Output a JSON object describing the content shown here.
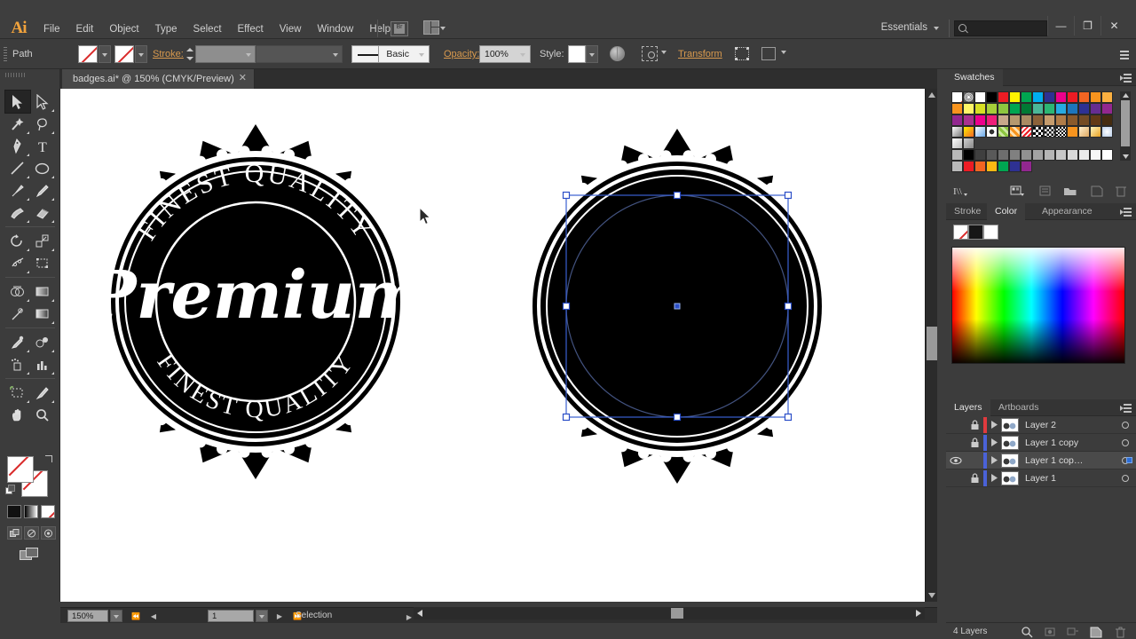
{
  "app": {
    "name": "Adobe Illustrator",
    "logo_text": "Ai"
  },
  "menubar": {
    "items": [
      "File",
      "Edit",
      "Object",
      "Type",
      "Select",
      "Effect",
      "View",
      "Window",
      "Help"
    ],
    "workspace": "Essentials",
    "search_placeholder": "",
    "bridge_icon": "bridge-icon",
    "arrange_icon": "arrange-documents-icon",
    "window_buttons": {
      "minimize": "—",
      "restore": "❐",
      "close": "✕"
    }
  },
  "controlbar": {
    "selection_type": "Path",
    "fill_label": "fill-none",
    "stroke_label": "Stroke:",
    "stroke_weight": "",
    "stroke_profile": "",
    "brush_definition": "Basic",
    "opacity_label": "Opacity:",
    "opacity_value": "100%",
    "style_label": "Style:",
    "transform_label": "Transform",
    "isolate_icon": "isolate-group-icon",
    "align_icon": "align-icon",
    "recolor_icon": "recolor-artwork-icon",
    "flyout_icon": "panel-menu-icon"
  },
  "document_tab": {
    "title": "badges.ai* @ 150% (CMYK/Preview)",
    "close": "✕"
  },
  "toolbar": {
    "tools": [
      "selection-tool",
      "direct-selection-tool",
      "magic-wand-tool",
      "lasso-tool",
      "pen-tool",
      "type-tool",
      "line-segment-tool",
      "ellipse-tool",
      "paintbrush-tool",
      "pencil-tool",
      "blob-brush-tool",
      "eraser-tool",
      "rotate-tool",
      "scale-tool",
      "width-tool",
      "free-transform-tool",
      "shape-builder-tool",
      "perspective-grid-tool",
      "mesh-tool",
      "gradient-tool",
      "eyedropper-tool",
      "blend-tool",
      "symbol-sprayer-tool",
      "column-graph-tool",
      "artboard-tool",
      "slice-tool",
      "hand-tool",
      "zoom-tool"
    ],
    "selected_tool": "selection-tool",
    "fill_color": "none",
    "stroke_color": "none",
    "color_modes": [
      "color-mode",
      "gradient-mode",
      "none-mode"
    ],
    "draw_modes": [
      "draw-normal",
      "draw-behind",
      "draw-inside"
    ],
    "screen_mode": "change-screen-mode"
  },
  "canvas": {
    "badge_left": {
      "top_arc_text": "FINEST QUALITY",
      "center_text": "Premium",
      "bottom_arc_text": "FINEST QUALITY",
      "fill": "#000000"
    },
    "badge_right": {
      "selection": "circle-path-selected",
      "selection_color": "#2b4ec7",
      "fill": "#000000"
    },
    "cursor": "arrow-cursor"
  },
  "statusbar": {
    "zoom_level": "150%",
    "page_number": "1",
    "status_text": "Selection"
  },
  "panels": {
    "swatches": {
      "tab": "Swatches",
      "rows": [
        [
          "none",
          "registration",
          "#ffffff",
          "#000000",
          "#ed1c24",
          "#fff200",
          "#00a651",
          "#00aeef",
          "#2e3192",
          "#ec008c",
          "#ed1c24",
          "#f26522",
          "#f7941e",
          "#fbb040"
        ],
        [
          "#f7941e",
          "#fff568",
          "#d7df23",
          "#a6ce39",
          "#8dc63f",
          "#00a651",
          "#007934",
          "#4bb798",
          "#2bb673",
          "#27aae1",
          "#1c75bc",
          "#2e3192",
          "#662d91",
          "#92278f"
        ],
        [
          "#92278f",
          "#a9318f",
          "#ec008c",
          "#ed1e79",
          "#c8a88b",
          "#b5996f",
          "#a98b63",
          "#8c6239",
          "#c69c6d",
          "#b07c48",
          "#8a5a2b",
          "#754c24",
          "#633a16",
          "#452c10"
        ],
        [
          "gradient-white-black",
          "gradient-orange",
          "gradient-blue",
          "pattern-dot",
          "pattern-leaf",
          "pattern-floral",
          "pattern-red",
          "pattern-poly1",
          "pattern-poly2",
          "pattern-poly3",
          "#f7941e",
          "gradient-tan",
          "gradient-gold",
          "gradient-radial"
        ],
        [
          "gradient-silver",
          "gradient-grey"
        ],
        [
          "folder",
          "#000000",
          "#3f3f3f",
          "#595959",
          "#6e6e6e",
          "#808080",
          "#919191",
          "#a3a3a3",
          "#b5b5b5",
          "#c7c7c7",
          "#d9d9d9",
          "#ebebeb",
          "#f7f7f7",
          "#ffffff"
        ],
        [
          "folder",
          "#ed1c24",
          "#f26522",
          "#fdb913",
          "#00a651",
          "#2e3192",
          "#92278f"
        ]
      ],
      "footer_icons": [
        "swatch-libraries-icon",
        "show-swatch-kinds-icon",
        "swatch-options-icon",
        "new-color-group-icon",
        "new-swatch-icon",
        "delete-swatch-icon"
      ]
    },
    "color": {
      "tabs": [
        "Stroke",
        "Color",
        "Appearance"
      ],
      "active_tab": "Color",
      "chips": [
        "none",
        "#161616",
        "#ffffff"
      ],
      "spectrum": "cmyk-spectrum"
    },
    "layers": {
      "tabs": [
        "Layers",
        "Artboards"
      ],
      "active_tab": "Layers",
      "rows": [
        {
          "name": "Layer 2",
          "visible": false,
          "locked": true,
          "color": "#e03a3e",
          "selected": false
        },
        {
          "name": "Layer 1 copy",
          "visible": false,
          "locked": true,
          "color": "#4a62d8",
          "selected": false
        },
        {
          "name": "Layer 1 cop…",
          "visible": true,
          "locked": false,
          "color": "#4a62d8",
          "selected": true
        },
        {
          "name": "Layer 1",
          "visible": false,
          "locked": true,
          "color": "#4a62d8",
          "selected": false
        }
      ],
      "footer_text": "4 Layers",
      "footer_icons": [
        "locate-object-icon",
        "make-clipping-mask-icon",
        "create-new-sublayer-icon",
        "create-new-layer-icon",
        "delete-selection-icon"
      ]
    }
  }
}
